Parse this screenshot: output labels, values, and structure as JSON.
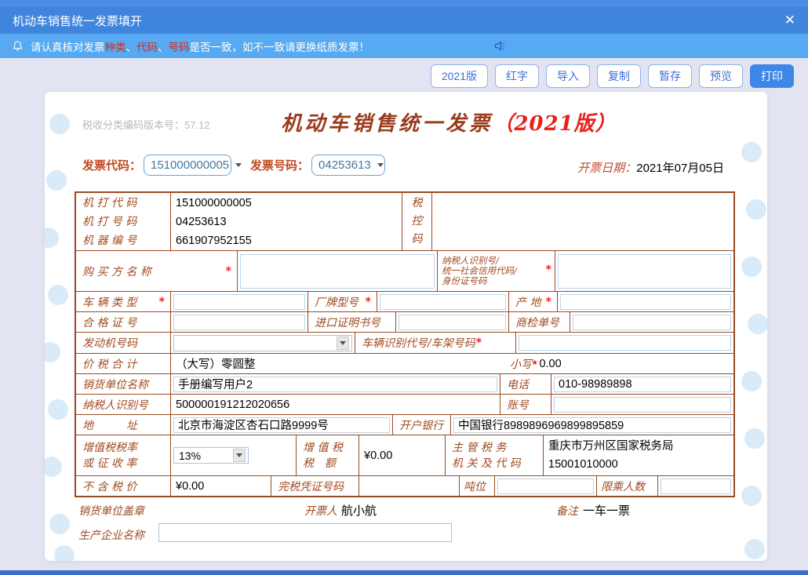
{
  "window": {
    "title": "机动车销售统一发票填开",
    "close_icon": "✕"
  },
  "notice": {
    "part1": "请认真核对发票",
    "hl1": "种类",
    "sep1": "、",
    "hl2": "代码",
    "sep2": "、",
    "hl3": "号码",
    "part2": "是否一致，如不一致请更换纸质发票！"
  },
  "toolbar": {
    "buttons": [
      "2021版",
      "红字",
      "导入",
      "复制",
      "暂存",
      "预览"
    ],
    "print_label": "打印"
  },
  "invoice": {
    "version_note": "税收分类编码版本号：57.12",
    "title_main": "机动车销售统一发票",
    "title_version": "（2021版）",
    "code_label": "发票代码：",
    "code_value": "151000000005",
    "number_label": "发票号码：",
    "number_value": "04253613",
    "date_label": "开票日期：",
    "date_value": "2021年07月05日"
  },
  "table": {
    "required_mark": "*",
    "machine_code_label": "机 打 代 码",
    "machine_code": "151000000005",
    "machine_number_label": "机 打 号 码",
    "machine_number": "04253613",
    "machine_id_label": "机 器 编 号",
    "machine_id": "661907952155",
    "tax_control_label": "税控码",
    "buyer_name_label": "购 买 方 名 称",
    "buyer_taxid_l1": "纳税人识别号/",
    "buyer_taxid_l2": "统一社会信用代码/",
    "buyer_taxid_l3": "身份证号码",
    "vehicle_type_label": "车 辆 类 型",
    "brand_model_label": "厂牌型号",
    "origin_label": "产 地",
    "cert_no_label": "合 格 证 号",
    "import_cert_label": "进口证明书号",
    "inspection_no_label": "商检单号",
    "engine_no_label": "发动机号码",
    "vin_label": "车辆识别代号/车架号码",
    "total_label": "价 税 合 计",
    "total_words": "（大写）零圆整",
    "total_small_label": "小写",
    "total_value": "0.00",
    "seller_name_label": "销货单位名称",
    "seller_name": "手册编写用户2",
    "phone_label": "电话",
    "phone": "010-98989898",
    "seller_taxid_label": "纳税人识别号",
    "seller_taxid": "500000191212020656",
    "account_label": "账号",
    "address_label": "地　　　址",
    "address": "北京市海淀区杏石口路9999号",
    "bank_label": "开户银行",
    "bank": "中国银行8989896969899895859",
    "vat_rate_label_l1": "增值税税率",
    "vat_rate_label_l2": "或 征 收 率",
    "vat_rate": "13%",
    "vat_amount_label_l1": "增 值 税",
    "vat_amount_label_l2": "税　额",
    "vat_amount": "¥0.00",
    "tax_authority_label_l1": "主 管 税 务",
    "tax_authority_label_l2": "机 关 及 代 码",
    "tax_authority_line1": "重庆市万州区国家税务局",
    "tax_authority_line2": "15001010000",
    "price_excl_label": "不 含 税 价",
    "price_excl": "¥0.00",
    "tax_cert_label": "完税凭证号码",
    "tonnage_label": "吨位",
    "passenger_label": "限乘人数"
  },
  "footer": {
    "seller_stamp_label": "销货单位盖章",
    "issuer_label": "开票人",
    "issuer": "航小航",
    "remark_label": "备注",
    "remark": "一车一票",
    "manufacturer_label": "生产企业名称"
  },
  "colors": {
    "titlebar_blue": "#3f85de",
    "notice_blue": "#57a9f1",
    "accent_blue": "#3e86e8",
    "table_border_brown": "#9a4a22",
    "label_brown": "#a04a20",
    "highlight_red": "#cf2b24"
  }
}
